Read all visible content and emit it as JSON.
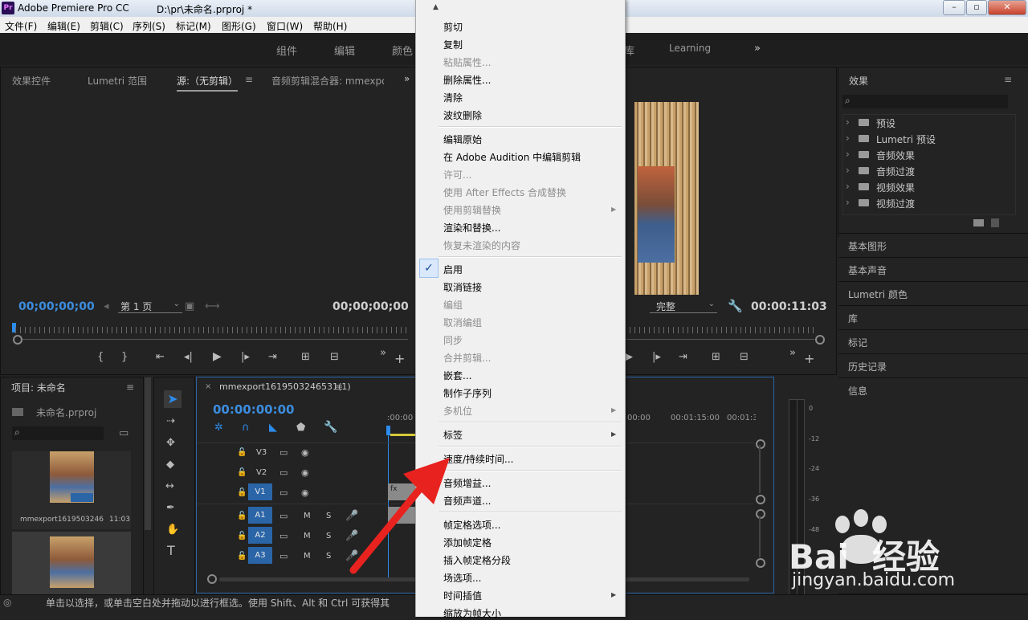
{
  "titlebar": {
    "app": "Adobe Premiere Pro CC",
    "path": "D:\\pr\\未命名.prproj *",
    "icon": "Pr"
  },
  "menubar": [
    "文件(F)",
    "编辑(E)",
    "剪辑(C)",
    "序列(S)",
    "标记(M)",
    "图形(G)",
    "窗口(W)",
    "帮助(H)"
  ],
  "workspaces": [
    "组件",
    "编辑",
    "颜色",
    "库",
    "Learning"
  ],
  "source_panel": {
    "tabs": [
      "效果控件",
      "Lumetri 范围",
      "源:（无剪辑）",
      "音频剪辑混合器: mmexpo"
    ],
    "timecode_left": "00;00;00;00",
    "page_select": "第 1 页",
    "timecode_right": "00;00;00;00"
  },
  "program_panel": {
    "quality": "完整",
    "timecode": "00:00:11:03"
  },
  "effects_panel": {
    "title": "效果",
    "items": [
      "预设",
      "Lumetri 预设",
      "音频效果",
      "音频过渡",
      "视频效果",
      "视频过渡"
    ],
    "sections": [
      "基本图形",
      "基本声音",
      "Lumetri 颜色",
      "库",
      "标记",
      "历史记录",
      "信息"
    ]
  },
  "project_panel": {
    "title": "项目: 未命名",
    "file": "未命名.prproj",
    "clip_name": "mmexport16195032465…",
    "clip_duration": "11:03"
  },
  "timeline": {
    "tab": "mmexport1619503246531(1)",
    "timecode": "00:00:00:00",
    "ruler": [
      ":00:00",
      "00:00",
      "00:01:15:00",
      "00:01:3"
    ],
    "video_tracks": [
      "V3",
      "V2",
      "V1"
    ],
    "audio_tracks": [
      "A1",
      "A2",
      "A3"
    ],
    "m_label": "M",
    "s_label": "S",
    "clip_tag": "fx"
  },
  "meter": {
    "labels": [
      "0",
      "-12",
      "-24",
      "-36",
      "-48"
    ]
  },
  "context_menu": {
    "items": [
      {
        "label": "剪切",
        "enabled": true
      },
      {
        "label": "复制",
        "enabled": true
      },
      {
        "label": "粘贴属性...",
        "enabled": false
      },
      {
        "label": "删除属性...",
        "enabled": true
      },
      {
        "label": "清除",
        "enabled": true
      },
      {
        "label": "波纹删除",
        "enabled": true
      },
      {
        "label": "编辑原始",
        "enabled": true
      },
      {
        "label": "在 Adobe Audition 中编辑剪辑",
        "enabled": true
      },
      {
        "label": "许可...",
        "enabled": false
      },
      {
        "label": "使用 After Effects 合成替换",
        "enabled": false
      },
      {
        "label": "使用剪辑替换",
        "enabled": false
      },
      {
        "label": "渲染和替换...",
        "enabled": true
      },
      {
        "label": "恢复未渲染的内容",
        "enabled": false
      },
      {
        "label": "启用",
        "enabled": true,
        "checked": true
      },
      {
        "label": "取消链接",
        "enabled": true
      },
      {
        "label": "编组",
        "enabled": false
      },
      {
        "label": "取消编组",
        "enabled": false
      },
      {
        "label": "同步",
        "enabled": false
      },
      {
        "label": "合并剪辑...",
        "enabled": false
      },
      {
        "label": "嵌套...",
        "enabled": true
      },
      {
        "label": "制作子序列",
        "enabled": true
      },
      {
        "label": "多机位",
        "enabled": false
      },
      {
        "label": "标签",
        "enabled": true
      },
      {
        "label": "速度/持续时间...",
        "enabled": true
      },
      {
        "label": "音频增益...",
        "enabled": true
      },
      {
        "label": "音频声道...",
        "enabled": true
      },
      {
        "label": "帧定格选项...",
        "enabled": true
      },
      {
        "label": "添加帧定格",
        "enabled": true
      },
      {
        "label": "插入帧定格分段",
        "enabled": true
      },
      {
        "label": "场选项...",
        "enabled": true
      },
      {
        "label": "时间插值",
        "enabled": true
      },
      {
        "label": "缩放为帧大小",
        "enabled": true
      }
    ]
  },
  "status_bar": {
    "text": "单击以选择，或单击空白处并拖动以进行框选。使用 Shift、Alt 和 Ctrl 可获得其"
  },
  "watermark": {
    "brand": "Bai  经验",
    "url": "jingyan.baidu.com"
  },
  "colors": {
    "accent_blue": "#2d8ceb",
    "track_blue": "#2a65a8",
    "arrow_red": "#e8231f",
    "timecode_blue": "#3c8ddf"
  }
}
